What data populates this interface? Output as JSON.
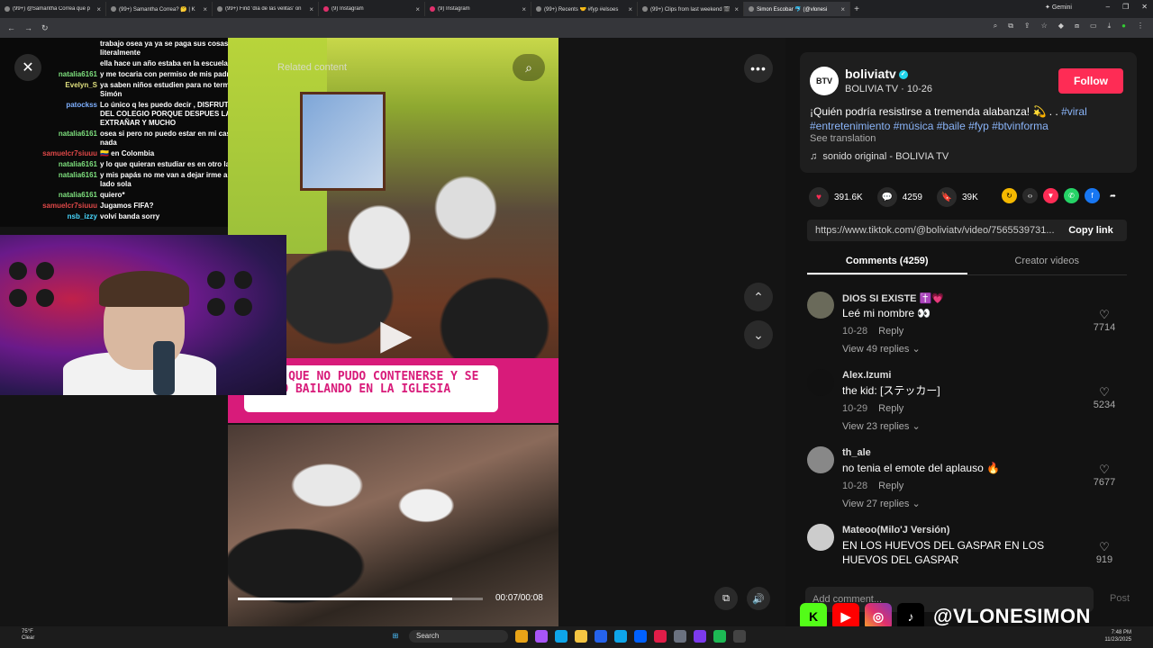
{
  "browser": {
    "tabs": [
      {
        "label": "(99+) @Samantha Correa que p",
        "icon": "kick-icon"
      },
      {
        "label": "(99+) Samantha Correa? 🤔 | K",
        "icon": "kick-icon"
      },
      {
        "label": "(99+) Find 'día de las velitas' on",
        "icon": "tiktok-icon"
      },
      {
        "label": "(9) Instagram",
        "icon": "instagram-icon"
      },
      {
        "label": "(9) Instagram",
        "icon": "instagram-icon"
      },
      {
        "label": "(99+) Recents 🤝 #fyp #elsoes",
        "icon": "tiktok-icon"
      },
      {
        "label": "(99+) Clips from last weekend 🎬",
        "icon": "tiktok-icon"
      },
      {
        "label": "Simon Escobar 🐬 (@vlonesi",
        "icon": "tiktok-icon",
        "active": true
      }
    ],
    "gemini_label": "Gemini"
  },
  "chat": [
    {
      "user": "",
      "color": "#ffffff",
      "text": "trabajo osea ya ya se paga sus cosas y literalmente"
    },
    {
      "user": "",
      "color": "#ffffff",
      "text": "ella hace un año estaba en la escuela"
    },
    {
      "user": "natalia6161",
      "color": "#7ee07e",
      "text": "y me tocaria con permiso de mis padres"
    },
    {
      "user": "Evelyn_S",
      "color": "#e0e07e",
      "text": "ya saben niños estudien para no terminar como Simón"
    },
    {
      "user": "patockss",
      "color": "#7eb0ff",
      "text": "Lo único q les puedo decir , DISFRUTEN LA VIDA DEL COLEGIO PORQUE DESPUES LA VAN A EXTRAÑAR Y MUCHO"
    },
    {
      "user": "natalia6161",
      "color": "#7ee07e",
      "text": "osea si pero no puedo estar en mi casa sin hacer nada"
    },
    {
      "user": "samuelcr7siuuu",
      "color": "#e04848",
      "text": "🇨🇴 en Colombia"
    },
    {
      "user": "natalia6161",
      "color": "#7ee07e",
      "text": "y lo que quieran estudiar es en otro lado"
    },
    {
      "user": "natalia6161",
      "color": "#7ee07e",
      "text": "y mis papás no me van a dejar irme a vivir a otro lado sola"
    },
    {
      "user": "natalia6161",
      "color": "#7ee07e",
      "text": "quiero*"
    },
    {
      "user": "samuelcr7siuuu",
      "color": "#e04848",
      "text": "Jugamos FIFA?"
    },
    {
      "user": "nsb_izzy",
      "color": "#48d8ff",
      "text": "volví banda sorry"
    }
  ],
  "player": {
    "close_icon": "✕",
    "related_label": "Related content",
    "banner_text": "NIÑO QUE NO PUDO CONTENERSE Y SE LUCIÓ BAILANDO EN LA IGLESIA",
    "time": "00:07/00:08",
    "progress": 0.875,
    "more_icon": "•••"
  },
  "author": {
    "avatar_text": "BTV",
    "username": "boliviatv",
    "subtitle": "BOLIVIA TV · 10-26",
    "follow_label": "Follow",
    "description": "¡Quién podría resistirse a tremenda alabanza! 💫 . . ",
    "hashtags": "#viral #entretenimiento #música #baile #fyp #btvinforma",
    "see_translation": "See translation",
    "sound": "sonido original - BOLIVIA TV"
  },
  "stats": {
    "likes": "391.6K",
    "comments": "4259",
    "saves": "39K"
  },
  "link": {
    "url": "https://www.tiktok.com/@boliviatv/video/7565539731...",
    "copy_label": "Copy link"
  },
  "tabs": {
    "comments": "Comments (4259)",
    "creator": "Creator videos"
  },
  "comments": [
    {
      "user": "DIOS SI EXISTE ✝️💗",
      "text": "Leé mi nombre 👀",
      "date": "10-28",
      "reply": "Reply",
      "replies": "View 49 replies ⌄",
      "likes": "7714"
    },
    {
      "user": "Alex.Izumi",
      "text": "the kid: [ステッカー]",
      "date": "10-29",
      "reply": "Reply",
      "replies": "View 23 replies ⌄",
      "likes": "5234"
    },
    {
      "user": "th_ale",
      "text": "no tenia el emote del aplauso 🔥",
      "date": "10-28",
      "reply": "Reply",
      "replies": "View 27 replies ⌄",
      "likes": "7677"
    },
    {
      "user": "Mateoo(Milo'J Versión)",
      "text": "EN LOS HUEVOS DEL GASPAR EN LOS HUEVOS DEL GASPAR",
      "date": "",
      "reply": "",
      "replies": "",
      "likes": "919"
    }
  ],
  "composer": {
    "placeholder": "Add comment...",
    "post_label": "Post"
  },
  "overlay": {
    "handle": "@VLONESIMON"
  },
  "taskbar": {
    "weather_temp": "75°F",
    "weather_desc": "Clear",
    "search_label": "Search",
    "time": "7:48 PM",
    "date": "11/23/2025"
  }
}
